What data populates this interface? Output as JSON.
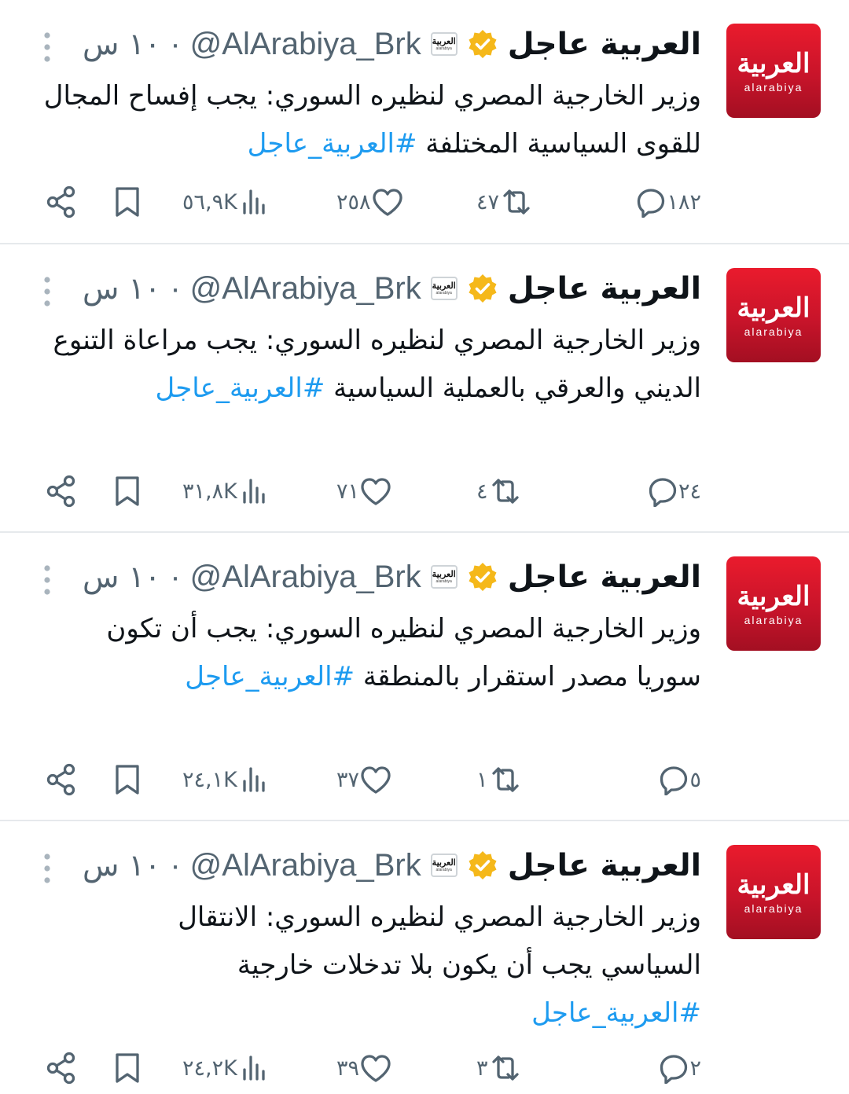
{
  "colors": {
    "accent": "#1d9bf0",
    "text": "#0f1419",
    "secondary": "#536471",
    "verified_gold": "#f5b81a",
    "avatar_red": "#d3142b"
  },
  "tweets": [
    {
      "avatar_logo": "العربية",
      "avatar_sub": "alarabiya",
      "name": "العربية عاجل",
      "badge_logo": "العربية",
      "badge_sub": "alarabiya",
      "handle": "@AlArabiya_Brk",
      "separator": "·",
      "time": "١٠ س",
      "text": "وزير الخارجية المصري لنظيره السوري: يجب إفساح المجال للقوى السياسية المختلفة ",
      "hashtag": "#العربية_عاجل",
      "replies": "١٨٢",
      "retweets": "٤٧",
      "likes": "٢٥٨",
      "views": "٥٦,٩K"
    },
    {
      "avatar_logo": "العربية",
      "avatar_sub": "alarabiya",
      "name": "العربية عاجل",
      "badge_logo": "العربية",
      "badge_sub": "alarabiya",
      "handle": "@AlArabiya_Brk",
      "separator": "·",
      "time": "١٠ س",
      "text": "وزير الخارجية المصري لنظيره السوري: يجب مراعاة التنوع الديني والعرقي بالعملية السياسية ",
      "hashtag": "#العربية_عاجل",
      "replies": "٢٤",
      "retweets": "٤",
      "likes": "٧١",
      "views": "٣١,٨K"
    },
    {
      "avatar_logo": "العربية",
      "avatar_sub": "alarabiya",
      "name": "العربية عاجل",
      "badge_logo": "العربية",
      "badge_sub": "alarabiya",
      "handle": "@AlArabiya_Brk",
      "separator": "·",
      "time": "١٠ س",
      "text": "وزير الخارجية المصري لنظيره السوري: يجب أن تكون سوريا مصدر استقرار بالمنطقة ",
      "hashtag": "#العربية_عاجل",
      "replies": "٥",
      "retweets": "١",
      "likes": "٣٧",
      "views": "٢٤,١K"
    },
    {
      "avatar_logo": "العربية",
      "avatar_sub": "alarabiya",
      "name": "العربية عاجل",
      "badge_logo": "العربية",
      "badge_sub": "alarabiya",
      "handle": "@AlArabiya_Brk",
      "separator": "·",
      "time": "١٠ س",
      "text": "وزير الخارجية المصري لنظيره السوري: الانتقال السياسي يجب أن يكون بلا تدخلات خارجية ",
      "hashtag": "#العربية_عاجل",
      "replies": "٢",
      "retweets": "٣",
      "likes": "٣٩",
      "views": "٢٤,٢K"
    }
  ]
}
